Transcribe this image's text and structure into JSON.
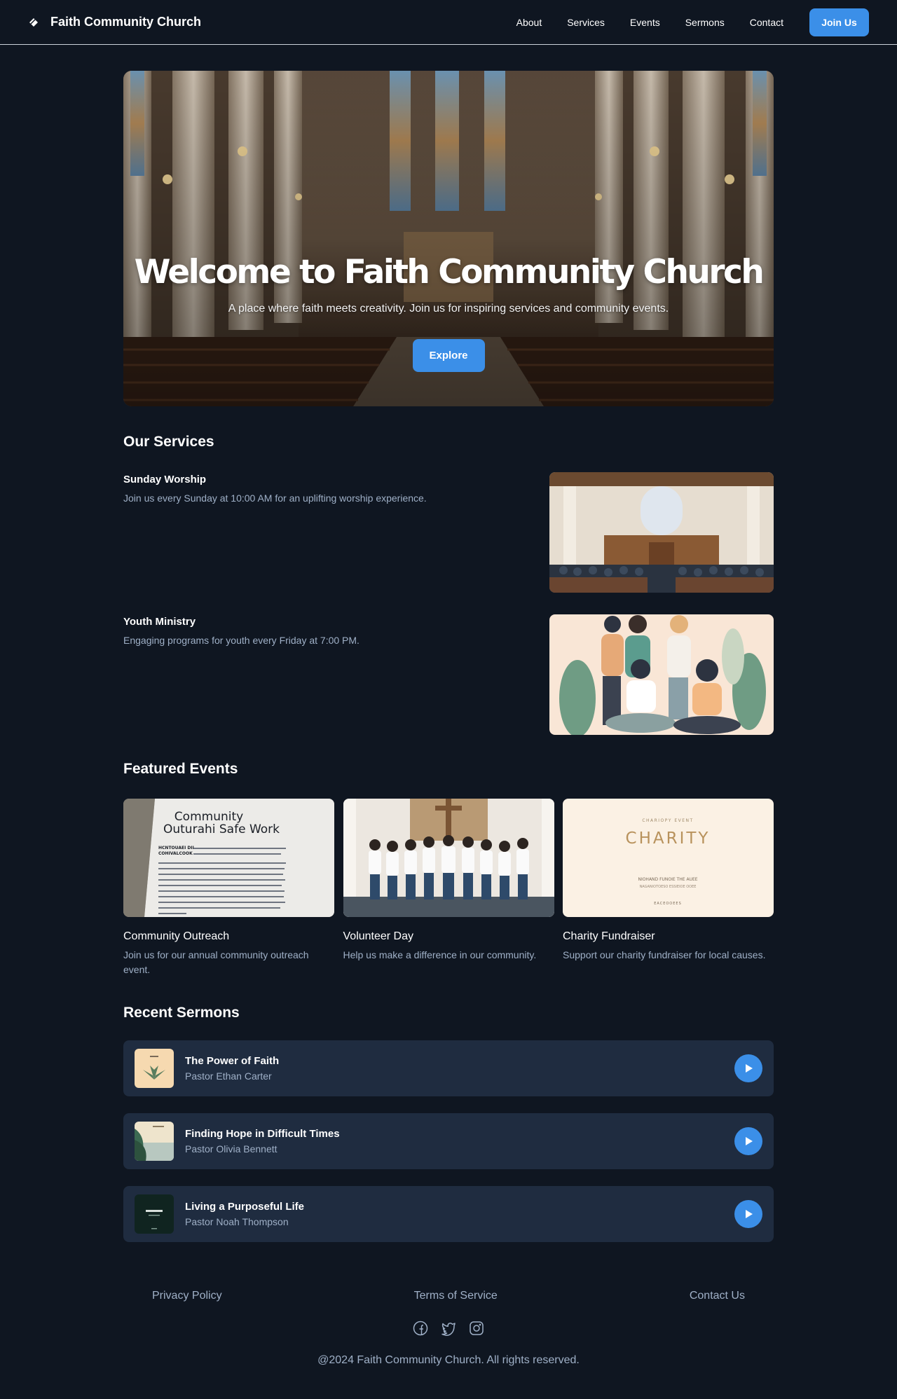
{
  "brand": {
    "name": "Faith Community Church"
  },
  "nav": {
    "links": [
      "About",
      "Services",
      "Events",
      "Sermons",
      "Contact"
    ],
    "cta": "Join Us"
  },
  "hero": {
    "title": "Welcome to Faith Community Church",
    "subtitle": "A place where faith meets creativity. Join us for inspiring services and community events.",
    "button": "Explore"
  },
  "services": {
    "title": "Our Services",
    "items": [
      {
        "name": "Sunday Worship",
        "desc": "Join us every Sunday at 10:00 AM for an uplifting worship experience."
      },
      {
        "name": "Youth Ministry",
        "desc": "Engaging programs for youth every Friday at 7:00 PM."
      }
    ]
  },
  "events": {
    "title": "Featured Events",
    "items": [
      {
        "name": "Community Outreach",
        "desc": "Join us for our annual community outreach event.",
        "image_text": {
          "heading": "Community Outurahi Safe Work",
          "subhead": "HCNTOUAEI DIL COHIVALCOOK"
        }
      },
      {
        "name": "Volunteer Day",
        "desc": "Help us make a difference in our community."
      },
      {
        "name": "Charity Fundraiser",
        "desc": "Support our charity fundraiser for local causes.",
        "image_text": {
          "kicker": "CHARIOPY EVENT",
          "heading": "CHARITY",
          "line1": "NIOHAND FUNOIE THE AUEE",
          "line2": "NAGANIOTOESO ESSIEIOE OOEE",
          "line3": "EACEOOEES"
        }
      }
    ]
  },
  "sermons": {
    "title": "Recent Sermons",
    "items": [
      {
        "title": "The Power of Faith",
        "author": "Pastor Ethan Carter"
      },
      {
        "title": "Finding Hope in Difficult Times",
        "author": "Pastor Olivia Bennett"
      },
      {
        "title": "Living a Purposeful Life",
        "author": "Pastor Noah Thompson"
      }
    ]
  },
  "footer": {
    "links": [
      "Privacy Policy",
      "Terms of Service",
      "Contact Us"
    ],
    "socials": [
      "facebook-icon",
      "twitter-icon",
      "instagram-icon"
    ],
    "copyright": "@2024 Faith Community Church. All rights reserved."
  },
  "colors": {
    "background": "#0f1621",
    "accent": "#3b8fe8",
    "card": "#1f2c40",
    "muted_text": "#9fb0c7"
  }
}
